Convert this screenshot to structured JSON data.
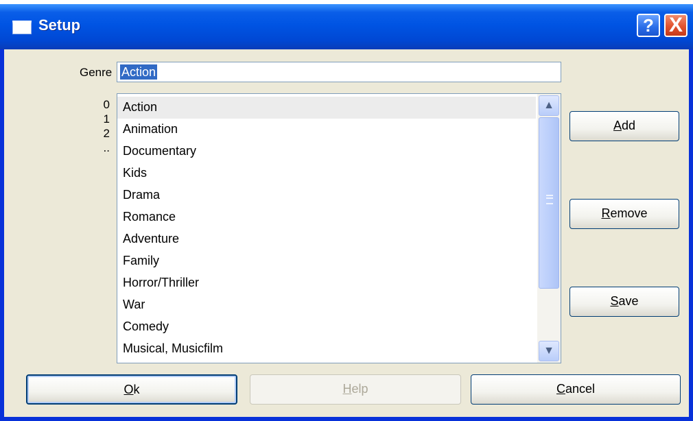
{
  "window": {
    "title": "Setup"
  },
  "titlebar": {
    "help_glyph": "?",
    "close_glyph": "X"
  },
  "genre": {
    "label": "Genre",
    "value": "Action"
  },
  "index_labels": [
    "0",
    "1",
    "2",
    ".."
  ],
  "list": {
    "items": [
      "Action",
      "Animation",
      "Documentary",
      "Kids",
      "Drama",
      "Romance",
      "Adventure",
      "Family",
      "Horror/Thriller",
      "War",
      "Comedy",
      "Musical, Musicfilm"
    ],
    "selected": "Action"
  },
  "buttons": {
    "add": {
      "mnemonic": "A",
      "rest": "dd"
    },
    "remove": {
      "mnemonic": "R",
      "rest": "emove"
    },
    "save": {
      "mnemonic": "S",
      "rest": "ave"
    },
    "ok": {
      "mnemonic": "O",
      "rest": "k"
    },
    "help": {
      "mnemonic": "H",
      "rest": "elp"
    },
    "cancel": {
      "mnemonic": "C",
      "rest": "ancel"
    }
  },
  "colors": {
    "titlebar": "#0054e3",
    "selection": "#316ac5",
    "face": "#ece9d8",
    "close": "#e2532f"
  }
}
